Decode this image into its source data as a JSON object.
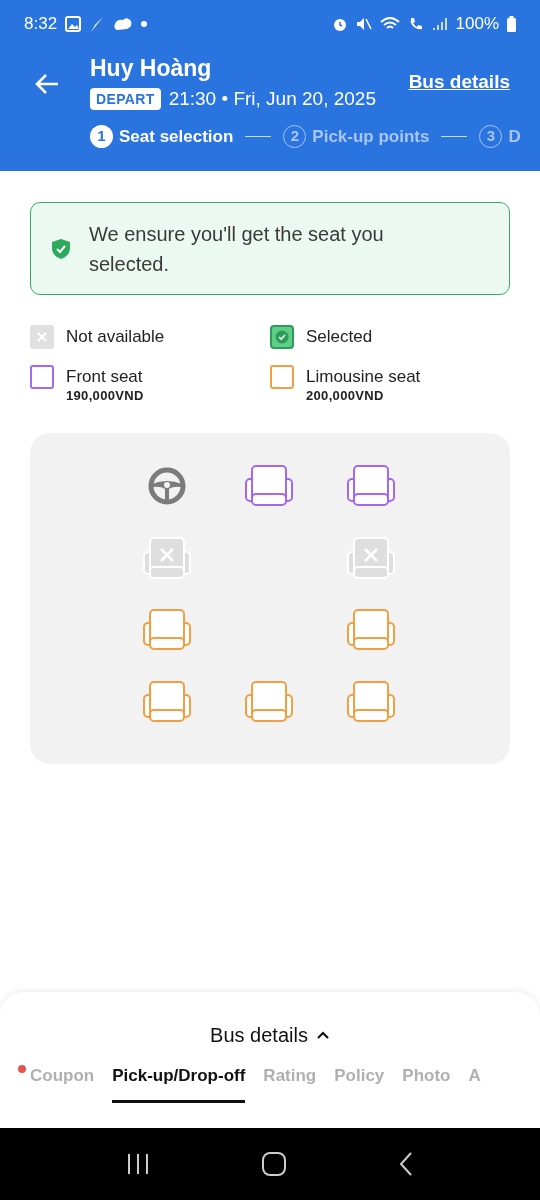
{
  "status_bar": {
    "time": "8:32",
    "battery": "100%"
  },
  "header": {
    "title": "Huy Hoàng",
    "badge": "DEPART",
    "departure": "21:30 • Fri, Jun 20, 2025",
    "link": "Bus details"
  },
  "steps": [
    {
      "number": "1",
      "label": "Seat selection",
      "selected": true
    },
    {
      "number": "2",
      "label": "Pick-up points",
      "selected": false
    },
    {
      "number": "3",
      "label": "D",
      "selected": false
    }
  ],
  "notice": "We ensure you'll get the seat you selected.",
  "legend": [
    {
      "kind": "unavailable",
      "label": "Not available"
    },
    {
      "kind": "selected",
      "label": "Selected"
    },
    {
      "kind": "front",
      "label": "Front seat",
      "price": "190,000VND"
    },
    {
      "kind": "limousine",
      "label": "Limousine seat",
      "price": "200,000VND"
    }
  ],
  "seat_rows": [
    {
      "seats": [
        {
          "kind": "driver"
        },
        {
          "kind": "front"
        },
        {
          "kind": "front"
        }
      ]
    },
    {
      "seats": [
        {
          "kind": "unavailable"
        },
        {
          "kind": "aisle"
        },
        {
          "kind": "unavailable"
        }
      ]
    },
    {
      "seats": [
        {
          "kind": "limousine"
        },
        {
          "kind": "aisle"
        },
        {
          "kind": "limousine"
        }
      ]
    },
    {
      "seats": [
        {
          "kind": "limousine"
        },
        {
          "kind": "limousine"
        },
        {
          "kind": "limousine"
        }
      ]
    }
  ],
  "bottom_sheet": {
    "title": "Bus details",
    "tabs": [
      {
        "label": "Coupon",
        "selected": false,
        "dot": true
      },
      {
        "label": "Pick-up/Drop-off",
        "selected": true,
        "dot": false
      },
      {
        "label": "Rating",
        "selected": false,
        "dot": false
      },
      {
        "label": "Policy",
        "selected": false,
        "dot": false
      },
      {
        "label": "Photo",
        "selected": false,
        "dot": false
      },
      {
        "label": "A",
        "selected": false,
        "dot": false
      }
    ]
  }
}
